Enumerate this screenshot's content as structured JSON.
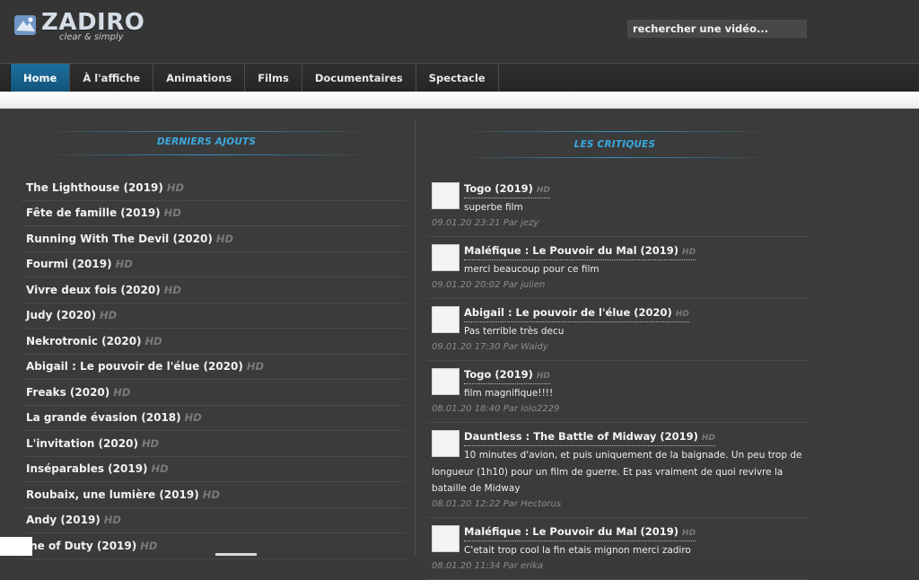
{
  "header": {
    "logo_text": "ZADIRO",
    "tagline": "clear & simply",
    "search_text": "rechercher une vidéo..."
  },
  "nav": {
    "items": [
      {
        "label": "Home",
        "active": true
      },
      {
        "label": "À l'affiche"
      },
      {
        "label": "Animations"
      },
      {
        "label": "Films"
      },
      {
        "label": "Documentaires"
      },
      {
        "label": "Spectacle"
      }
    ]
  },
  "latest": {
    "title": "DERNIERS AJOUTS",
    "badge": "HD",
    "items": [
      {
        "title": "The Lighthouse (2019)"
      },
      {
        "title": "Fête de famille (2019)"
      },
      {
        "title": "Running With The Devil (2020)"
      },
      {
        "title": "Fourmi (2019)"
      },
      {
        "title": "Vivre deux fois (2020)"
      },
      {
        "title": "Judy (2020)"
      },
      {
        "title": "Nekrotronic (2020)"
      },
      {
        "title": "Abigail : Le pouvoir de l'élue (2020)"
      },
      {
        "title": "Freaks (2020)"
      },
      {
        "title": "La grande évasion (2018)"
      },
      {
        "title": "L'invitation (2020)"
      },
      {
        "title": "Inséparables (2019)"
      },
      {
        "title": "Roubaix, une lumière (2019)"
      },
      {
        "title": "Andy (2019)"
      },
      {
        "title": "ine of Duty (2019)"
      }
    ]
  },
  "reviews": {
    "title": "LES CRITIQUES",
    "badge": "HD",
    "items": [
      {
        "title": "Togo (2019)",
        "text": "superbe film",
        "meta": "09.01.20 23:21 Par jezy"
      },
      {
        "title": "Maléfique : Le Pouvoir du Mal (2019)",
        "text": "merci beaucoup pour ce film",
        "meta": "09.01.20 20:02 Par julien"
      },
      {
        "title": "Abigail : Le pouvoir de l'élue (2020)",
        "text": "Pas terrible très decu",
        "meta": "09.01.20 17:30 Par Waidy"
      },
      {
        "title": "Togo (2019)",
        "text": "film magnifique!!!!",
        "meta": "08.01.20 18:40 Par lolo2229"
      },
      {
        "title": "Dauntless : The Battle of Midway (2019)",
        "text_first": "10 minutes d'avion, et puis uniquement de la baignade. Un peu trop de",
        "text_rest": "longueur (1h10) pour un film de guerre. Et pas vraiment de quoi revivre la bataille de Midway",
        "meta": "08.01.20 12:22 Par Hectorus"
      },
      {
        "title": "Maléfique : Le Pouvoir du Mal (2019)",
        "text": "C'etait trop cool la fin etais mignon merci zadiro",
        "meta": "08.01.20 11:34 Par erika"
      }
    ]
  },
  "colors": {
    "accent": "#3aa9e0",
    "nav_active": "#1d6f9e",
    "background": "#3b3b3b"
  }
}
